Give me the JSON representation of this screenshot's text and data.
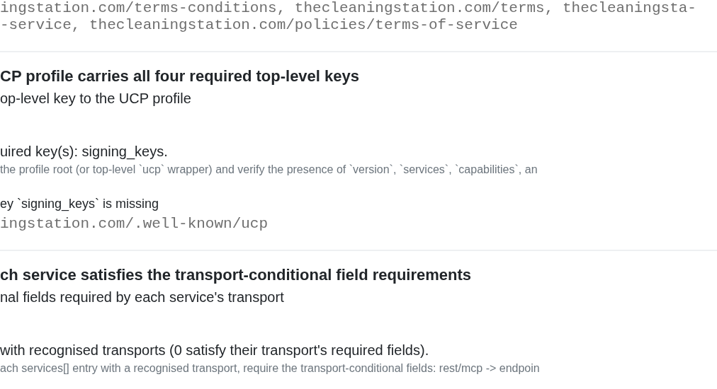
{
  "evidence_lines": [
    "ingstation.com/terms-conditions, thecleaningstation.com/terms, thecleaningsta-",
    "-service, thecleaningstation.com/policies/terms-of-service"
  ],
  "checks": [
    {
      "title": "CP profile carries all four required top-level keys",
      "description": "op-level key to the UCP profile",
      "result": "uired key(s): signing_keys.",
      "method": "the profile root (or top-level `ucp` wrapper) and verify the presence of `version`, `services`, `capabilities`, an",
      "finding": "ey `signing_keys` is missing",
      "location": "ingstation.com/.well-known/ucp"
    },
    {
      "title": "ch service satisfies the transport-conditional field requirements",
      "description": "nal fields required by each service's transport",
      "result": "with recognised transports (0 satisfy their transport's required fields).",
      "method": "ach services[] entry with a recognised transport, require the transport-conditional fields: rest/mcp -> endpoin"
    }
  ]
}
